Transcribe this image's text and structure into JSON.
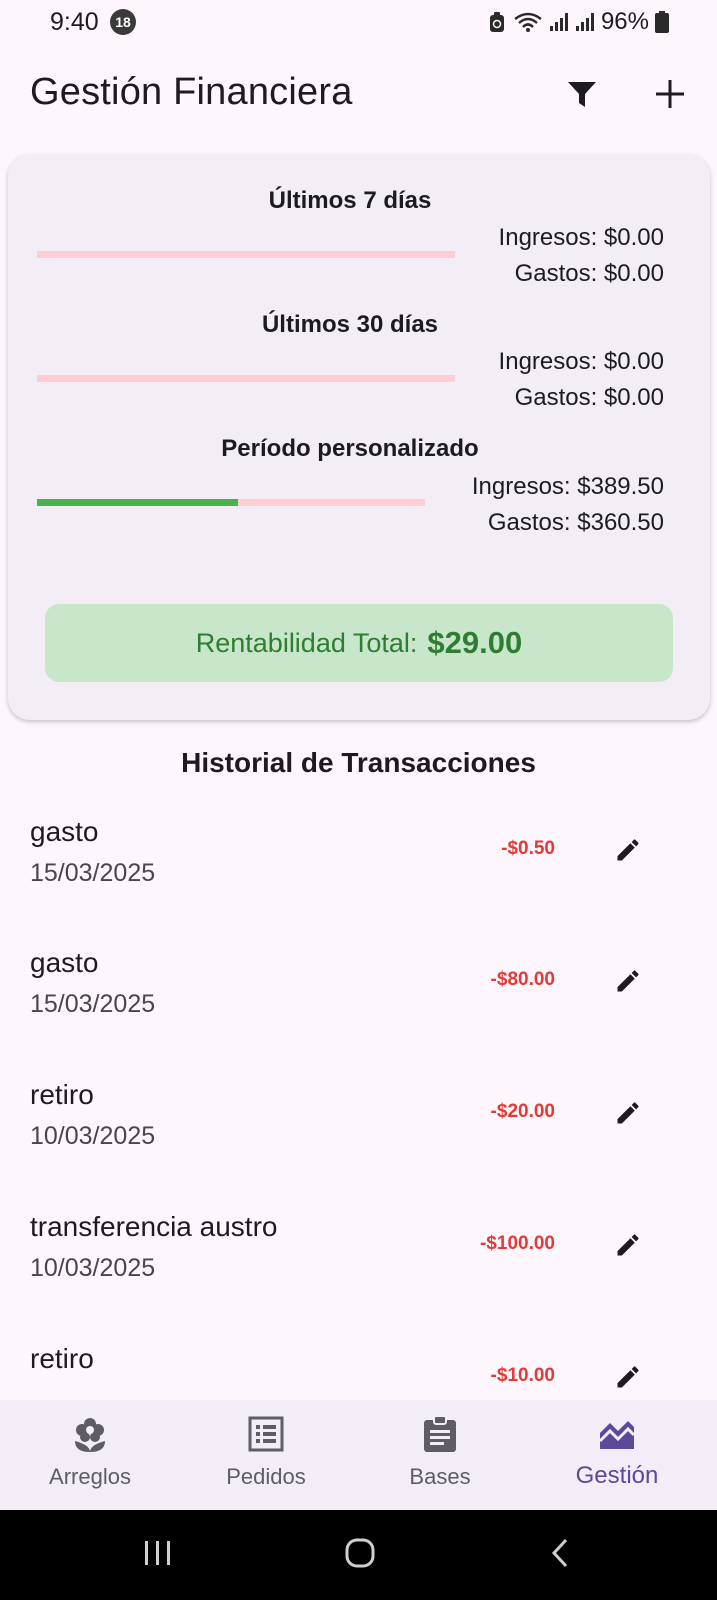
{
  "status_bar": {
    "time": "9:40",
    "notification_count": "18",
    "battery": "96%"
  },
  "app_bar": {
    "title": "Gestión Financiera",
    "filter_icon": "filter-icon",
    "add_icon": "add-icon"
  },
  "summary": {
    "periods": [
      {
        "title": "Últimos 7 días",
        "income": "Ingresos: $0.00",
        "expense": "Gastos: $0.00",
        "income_share": 0
      },
      {
        "title": "Últimos 30 días",
        "income": "Ingresos: $0.00",
        "expense": "Gastos: $0.00",
        "income_share": 0
      },
      {
        "title": "Período personalizado",
        "income": "Ingresos: $389.50",
        "expense": "Gastos: $360.50",
        "income_share": 0.519
      }
    ],
    "profit_label": "Rentabilidad Total:",
    "profit_value": "$29.00"
  },
  "history": {
    "title": "Historial de Transacciones",
    "transactions": [
      {
        "name": "gasto",
        "date": "15/03/2025",
        "amount": "-$0.50"
      },
      {
        "name": "gasto",
        "date": "15/03/2025",
        "amount": "-$80.00"
      },
      {
        "name": "retiro",
        "date": "10/03/2025",
        "amount": "-$20.00"
      },
      {
        "name": "transferencia austro",
        "date": "10/03/2025",
        "amount": "-$100.00"
      },
      {
        "name": "retiro",
        "date": "",
        "amount": "-$10.00"
      }
    ]
  },
  "bottom_nav": {
    "items": [
      {
        "label": "Arreglos",
        "icon": "flower-icon",
        "active": false
      },
      {
        "label": "Pedidos",
        "icon": "list-icon",
        "active": false
      },
      {
        "label": "Bases",
        "icon": "clipboard-icon",
        "active": false
      },
      {
        "label": "Gestión",
        "icon": "chart-icon",
        "active": true
      }
    ]
  },
  "colors": {
    "background": "#fdf7fd",
    "card": "#f3edf6",
    "income_bar": "#4caf50",
    "expense_bar": "#ffcdd2",
    "expense_text": "#e53935",
    "profit_bg": "#c8e6c9",
    "profit_text": "#2e7d32",
    "active_nav": "#5b4a9a"
  }
}
